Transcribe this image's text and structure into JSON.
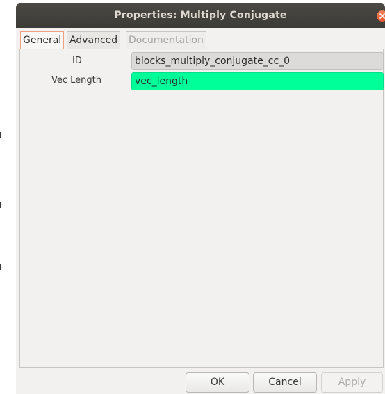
{
  "window": {
    "title": "Properties: Multiply Conjugate",
    "close_icon": "close-icon"
  },
  "tabs": [
    {
      "label": "General",
      "state": "active"
    },
    {
      "label": "Advanced",
      "state": "normal"
    },
    {
      "label": "Documentation",
      "state": "disabled"
    }
  ],
  "fields": {
    "id": {
      "label": "ID",
      "value": "blocks_multiply_conjugate_cc_0"
    },
    "vec_length": {
      "label": "Vec Length",
      "value": "vec_length"
    }
  },
  "buttons": {
    "ok": "OK",
    "cancel": "Cancel",
    "apply": "Apply"
  },
  "colors": {
    "titlebar": "#3c3b37",
    "vec_length_field": "#00ff99",
    "close_button": "#e95420"
  }
}
